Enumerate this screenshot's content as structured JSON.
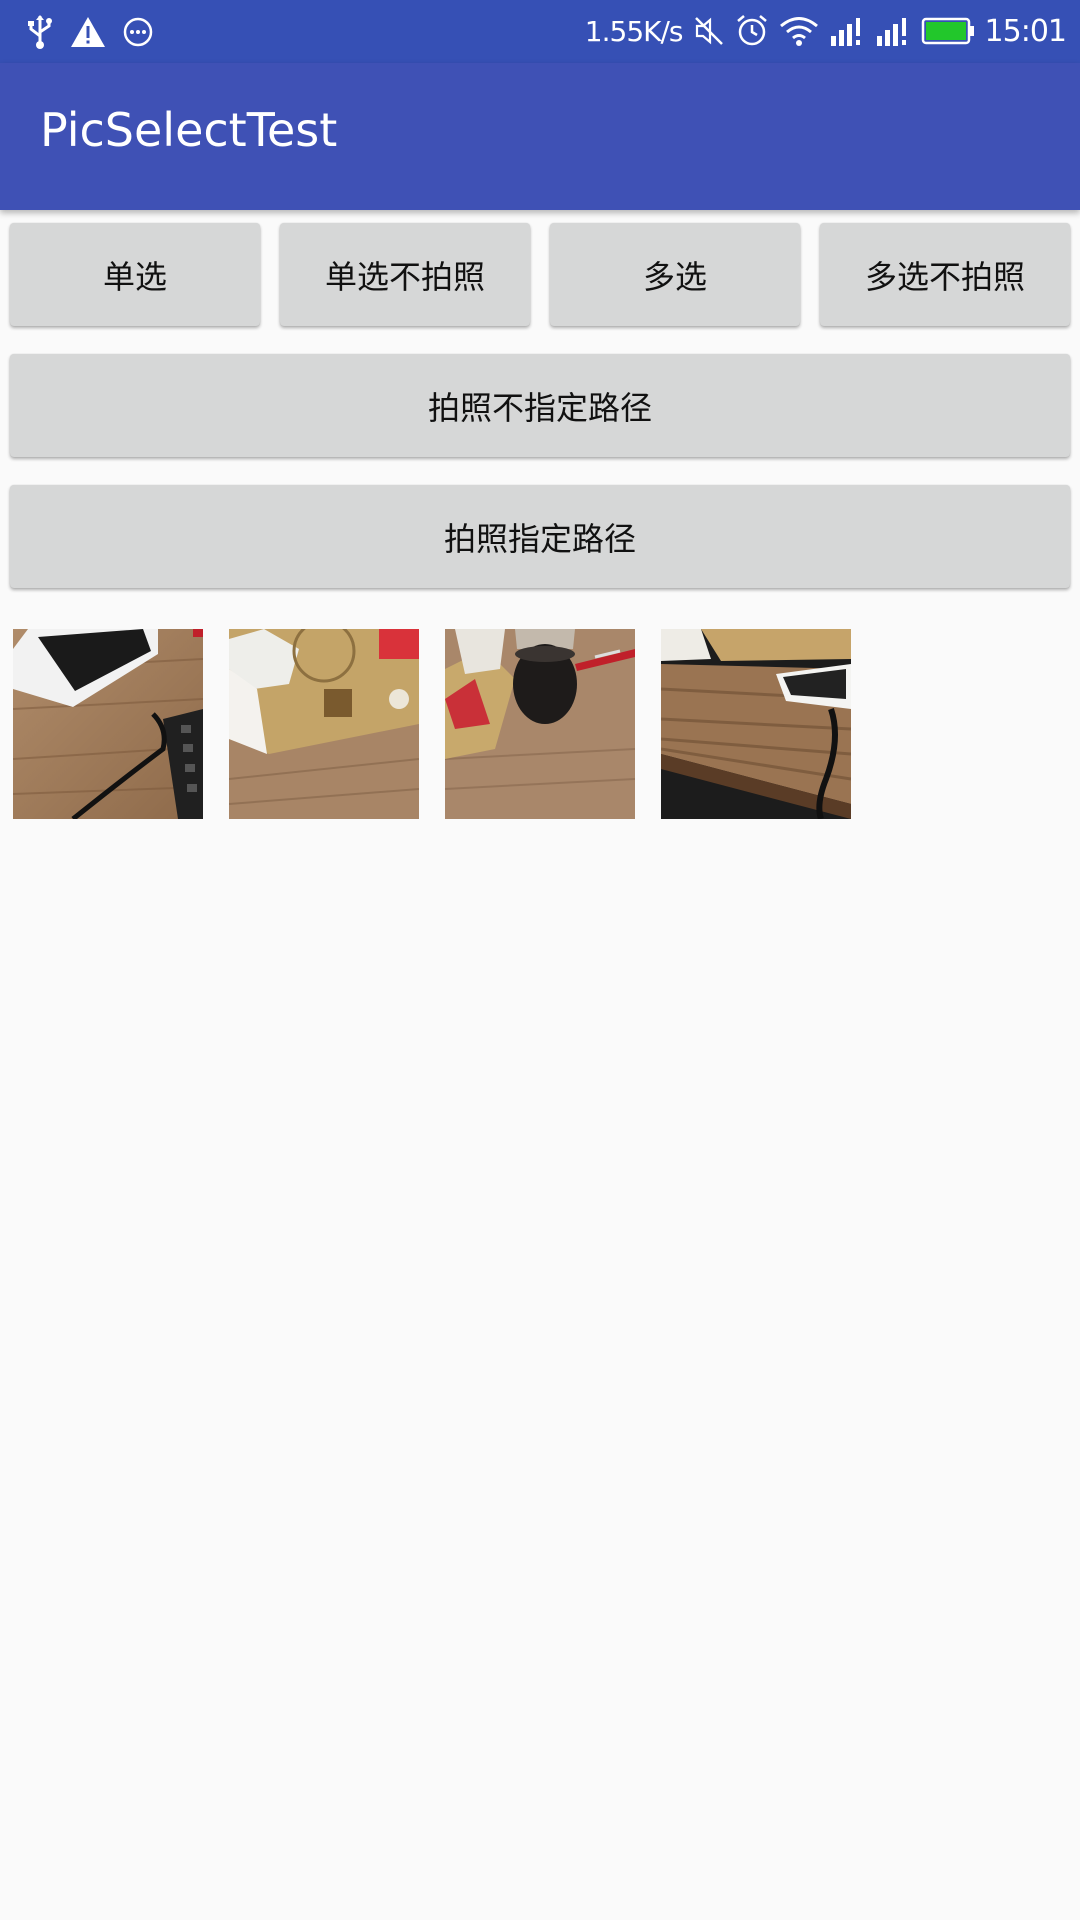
{
  "status_bar": {
    "net_speed": "1.55K/s",
    "time": "15:01",
    "left_icons": [
      "usb-icon",
      "warning-icon",
      "more-icon"
    ],
    "right_icons": [
      "mute-icon",
      "alarm-icon",
      "wifi-icon",
      "signal-icon",
      "signal-icon-2",
      "battery-icon"
    ],
    "battery_color": "#22c72b"
  },
  "app_bar": {
    "title": "PicSelectTest",
    "color": "#3f51b5"
  },
  "buttons": {
    "single_select": "单选",
    "single_no_camera": "单选不拍照",
    "multi_select": "多选",
    "multi_no_camera": "多选不拍照",
    "camera_no_path": "拍照不指定路径",
    "camera_with_path": "拍照指定路径"
  },
  "thumbnails": [
    {
      "name": "photo-phone-keyboard"
    },
    {
      "name": "photo-tissue-box"
    },
    {
      "name": "photo-cup-pen"
    },
    {
      "name": "photo-desk-phone"
    }
  ]
}
